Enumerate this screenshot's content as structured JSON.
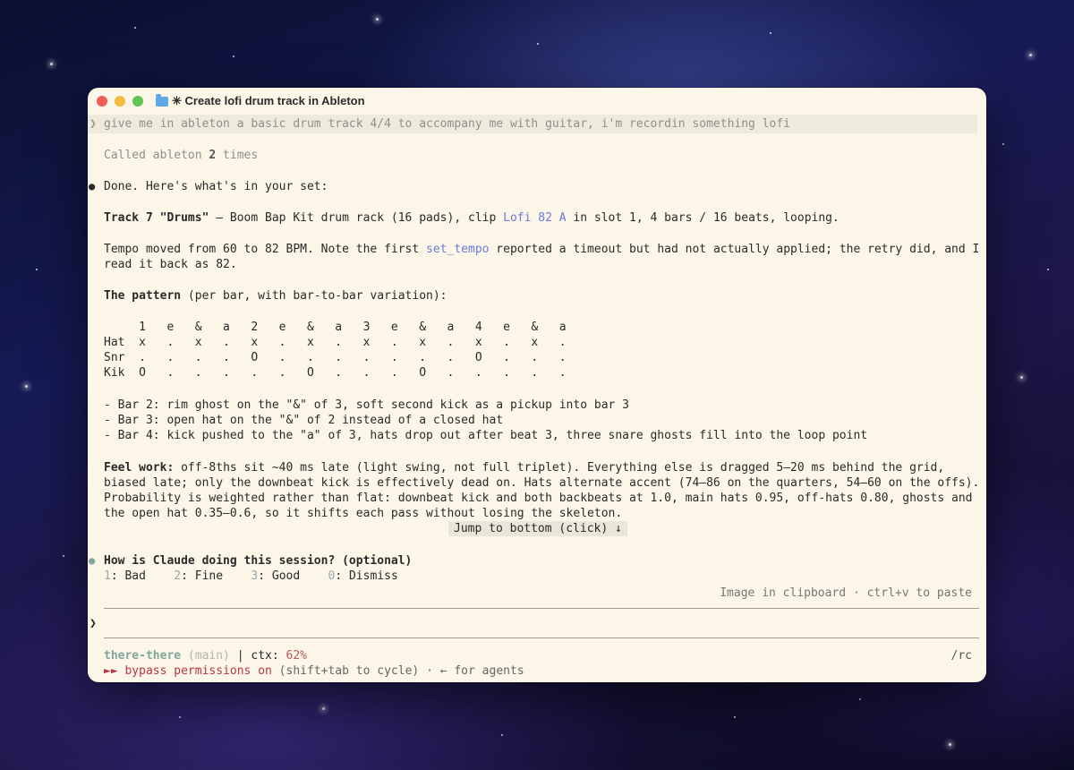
{
  "window": {
    "title": "✳ Create lofi drum track in Ableton",
    "traffic_colors": [
      "#ee5f57",
      "#f3bd3f",
      "#61c454"
    ]
  },
  "prompt": {
    "user_message": "give me in ableton a basic drum track 4/4 to accompany me with guitar, i'm recordin something lofi"
  },
  "tool_call": {
    "prefix": "Called ableton ",
    "count": "2",
    "suffix": " times"
  },
  "response": {
    "intro": "Done. Here's what's in your set:",
    "track_bold": "Track 7 \"Drums\"",
    "track_mid": " — Boom Bap Kit drum rack (16 pads), clip ",
    "clip_name": "Lofi 82 A",
    "track_end": " in slot 1, 4 bars / 16 beats, looping.",
    "tempo_1": "Tempo moved from 60 to 82 BPM. Note the first ",
    "tempo_fn": "set_tempo",
    "tempo_2": " reported a timeout but had not actually applied; the retry did, and I",
    "tempo_3": "read it back as 82.",
    "pattern_heading_bold": "The pattern",
    "pattern_heading_rest": " (per bar, with bar-to-bar variation):",
    "grid": [
      "     1   e   &   a   2   e   &   a   3   e   &   a   4   e   &   a",
      "Hat  x   .   x   .   x   .   x   .   x   .   x   .   x   .   x   .",
      "Snr  .   .   .   .   O   .   .   .   .   .   .   .   O   .   .   .",
      "Kik  O   .   .   .   .   .   O   .   .   .   O   .   .   .   .   ."
    ],
    "bars": [
      "- Bar 2: rim ghost on the \"&\" of 3, soft second kick as a pickup into bar 3",
      "- Bar 3: open hat on the \"&\" of 2 instead of a closed hat",
      "- Bar 4: kick pushed to the \"a\" of 3, hats drop out after beat 3, three snare ghosts fill into the loop point"
    ],
    "feel_bold": "Feel work:",
    "feel_lines": [
      " off-8ths sit ~40 ms late (light swing, not full triplet). Everything else is dragged 5–20 ms behind the grid,",
      "biased late; only the downbeat kick is effectively dead on. Hats alternate accent (74–86 on the quarters, 54–60 on the offs).",
      "Probability is weighted rather than flat: downbeat kick and both backbeats at 1.0, main hats 0.95, off-hats 0.80, ghosts and",
      "the open hat 0.35–0.6, so it shifts each pass without losing the skeleton."
    ]
  },
  "jump_to_bottom": "Jump to bottom (click) ↓",
  "feedback": {
    "question": "How is Claude doing this session? (optional)",
    "options": [
      {
        "key": "1",
        "label": ": Bad"
      },
      {
        "key": "2",
        "label": ": Fine"
      },
      {
        "key": "3",
        "label": ": Good"
      },
      {
        "key": "0",
        "label": ": Dismiss"
      }
    ]
  },
  "clipboard_hint": "Image in clipboard · ctrl+v to paste",
  "input_prompt": "❯",
  "status": {
    "project": "there-there",
    "branch": " (main)",
    "sep": " | ctx: ",
    "ctx": "62%",
    "command": "/rc",
    "bypass_arrow": "►► ",
    "bypass": "bypass permissions on",
    "bypass_rest": " (shift+tab to cycle) · ← for agents"
  }
}
